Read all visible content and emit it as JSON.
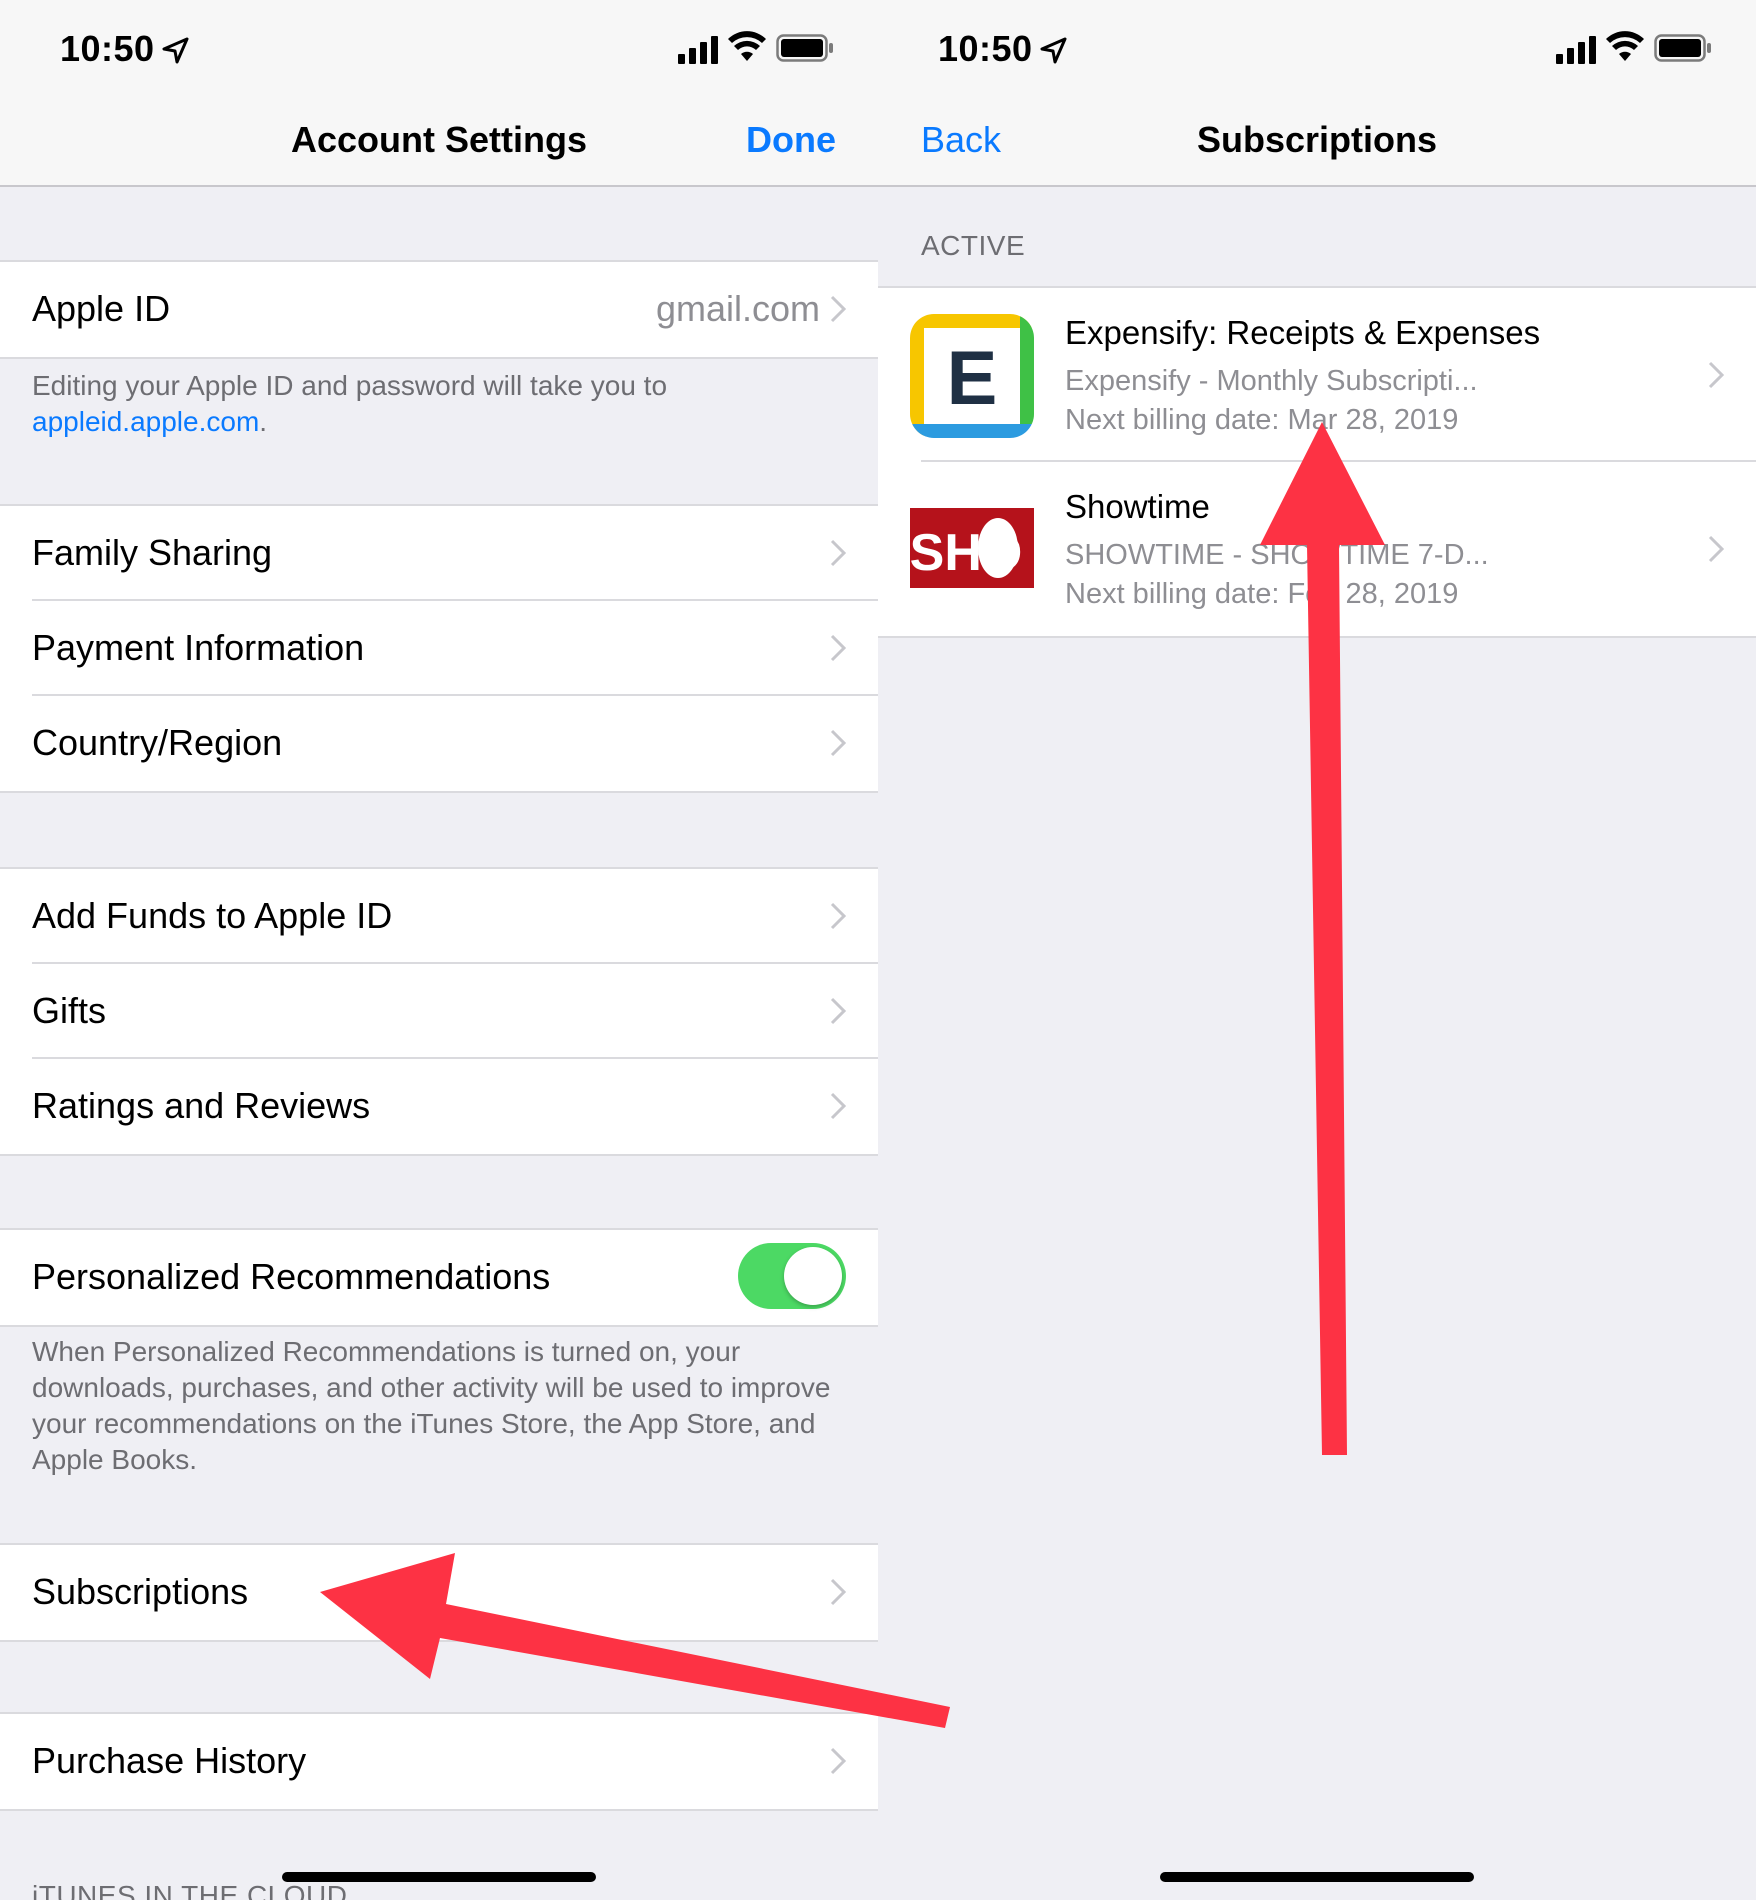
{
  "left": {
    "status": {
      "time": "10:50"
    },
    "nav": {
      "title": "Account Settings",
      "done": "Done"
    },
    "apple_id": {
      "label": "Apple ID",
      "value": "gmail.com"
    },
    "apple_id_footer": {
      "text": "Editing your Apple ID and password will take you to",
      "link": "appleid.apple.com",
      "end": "."
    },
    "group1": [
      "Family Sharing",
      "Payment Information",
      "Country/Region"
    ],
    "group2": [
      "Add Funds to Apple ID",
      "Gifts",
      "Ratings and Reviews"
    ],
    "personalized": {
      "label": "Personalized Recommendations",
      "on": true
    },
    "personalized_footer": "When Personalized Recommendations is turned on, your downloads, purchases, and other activity will be used to improve your recommendations on the iTunes Store, the App Store, and Apple Books.",
    "subscriptions": "Subscriptions",
    "purchase_history": "Purchase History",
    "cloud_header": "iTUNES IN THE CLOUD"
  },
  "right": {
    "status": {
      "time": "10:50"
    },
    "nav": {
      "back": "Back",
      "title": "Subscriptions"
    },
    "section": "ACTIVE",
    "items": [
      {
        "title": "Expensify: Receipts & Expenses",
        "detail": "Expensify - Monthly Subscripti...",
        "billing": "Next billing date: Mar 28, 2019",
        "icon": "expensify-icon"
      },
      {
        "title": "Showtime",
        "detail": "SHOWTIME - SHOWTIME 7-D...",
        "billing": "Next billing date: Feb 28, 2019",
        "icon": "showtime-icon",
        "icon_text": "SHO"
      }
    ]
  },
  "colors": {
    "accent": "#0a7aff",
    "toggle_on": "#4cd964",
    "annotation_arrow": "#fd3244",
    "background": "#efeff4"
  }
}
